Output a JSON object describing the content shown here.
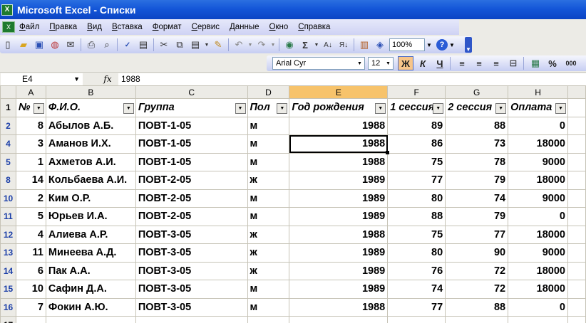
{
  "window": {
    "title": "Microsoft Excel - Списки"
  },
  "menu": [
    "Файл",
    "Правка",
    "Вид",
    "Вставка",
    "Формат",
    "Сервис",
    "Данные",
    "Окно",
    "Справка"
  ],
  "toolbar": {
    "zoom": "100%",
    "font_name": "Arial Cyr",
    "font_size": "12",
    "bold_label": "Ж",
    "italic_label": "К",
    "underline_label": "Ч",
    "percent_label": "%",
    "thousands_label": "000"
  },
  "formula_bar": {
    "name_box": "E4",
    "fx_label": "fx",
    "value": "1988"
  },
  "columns": [
    "A",
    "B",
    "C",
    "D",
    "E",
    "F",
    "G",
    "H"
  ],
  "header_row": {
    "row_number": "1",
    "cells": [
      "№",
      "Ф.И.О.",
      "Группа",
      "Пол",
      "Год рождения",
      "1 сессия",
      "2 сессия",
      "Оплата"
    ]
  },
  "rows": [
    {
      "rn": "2",
      "cells": [
        "8",
        "Абылов А.Б.",
        "ПОВТ-1-05",
        "м",
        "1988",
        "89",
        "88",
        "0"
      ]
    },
    {
      "rn": "4",
      "cells": [
        "3",
        "Аманов И.Х.",
        "ПОВТ-1-05",
        "м",
        "1988",
        "86",
        "73",
        "18000"
      ]
    },
    {
      "rn": "5",
      "cells": [
        "1",
        "Ахметов А.И.",
        "ПОВТ-1-05",
        "м",
        "1988",
        "75",
        "78",
        "9000"
      ]
    },
    {
      "rn": "8",
      "cells": [
        "14",
        "Кольбаева А.И.",
        "ПОВТ-2-05",
        "ж",
        "1989",
        "77",
        "79",
        "18000"
      ]
    },
    {
      "rn": "10",
      "cells": [
        "2",
        "Ким О.Р.",
        "ПОВТ-2-05",
        "м",
        "1989",
        "80",
        "74",
        "9000"
      ]
    },
    {
      "rn": "11",
      "cells": [
        "5",
        "Юрьев И.А.",
        "ПОВТ-2-05",
        "м",
        "1989",
        "88",
        "79",
        "0"
      ]
    },
    {
      "rn": "12",
      "cells": [
        "4",
        "Алиева А.Р.",
        "ПОВТ-3-05",
        "ж",
        "1988",
        "75",
        "77",
        "18000"
      ]
    },
    {
      "rn": "13",
      "cells": [
        "11",
        "Минеева А.Д.",
        "ПОВТ-3-05",
        "ж",
        "1989",
        "80",
        "90",
        "9000"
      ]
    },
    {
      "rn": "14",
      "cells": [
        "6",
        "Пак А.А.",
        "ПОВТ-3-05",
        "ж",
        "1989",
        "76",
        "72",
        "18000"
      ]
    },
    {
      "rn": "15",
      "cells": [
        "10",
        "Сафин Д.А.",
        "ПОВТ-3-05",
        "м",
        "1989",
        "74",
        "72",
        "18000"
      ]
    },
    {
      "rn": "16",
      "cells": [
        "7",
        "Фокин А.Ю.",
        "ПОВТ-3-05",
        "м",
        "1988",
        "77",
        "88",
        "0"
      ]
    }
  ],
  "trailing_row": {
    "rn": "17"
  }
}
